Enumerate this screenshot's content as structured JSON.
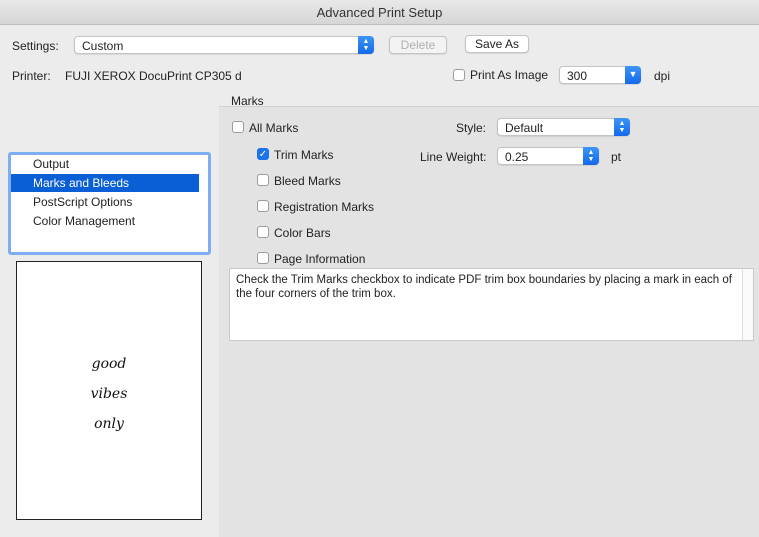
{
  "window": {
    "title": "Advanced Print Setup"
  },
  "settings": {
    "label": "Settings:",
    "value": "Custom",
    "delete_label": "Delete",
    "save_as_label": "Save As"
  },
  "printer": {
    "label": "Printer:",
    "name": "FUJI XEROX DocuPrint CP305 d",
    "print_as_image_label": "Print As Image",
    "dpi_value": "300",
    "dpi_unit": "dpi"
  },
  "sidebar": {
    "items": [
      {
        "label": "Output",
        "selected": false
      },
      {
        "label": "Marks and Bleeds",
        "selected": true
      },
      {
        "label": "PostScript Options",
        "selected": false
      },
      {
        "label": "Color Management",
        "selected": false
      }
    ]
  },
  "preview": {
    "lines": [
      "good",
      "vibes",
      "only"
    ]
  },
  "marks": {
    "section_label": "Marks",
    "all_marks_label": "All Marks",
    "trim_marks_label": "Trim Marks",
    "bleed_marks_label": "Bleed Marks",
    "registration_marks_label": "Registration Marks",
    "color_bars_label": "Color Bars",
    "page_information_label": "Page Information",
    "style_label": "Style:",
    "style_value": "Default",
    "line_weight_label": "Line Weight:",
    "line_weight_value": "0.25",
    "line_weight_unit": "pt"
  },
  "description": "Check the Trim Marks checkbox to indicate PDF trim box boundaries by placing a mark in each of the four corners of the trim box.",
  "colors": {
    "accent": "#1a73e8",
    "selection": "#0a5fd6"
  }
}
